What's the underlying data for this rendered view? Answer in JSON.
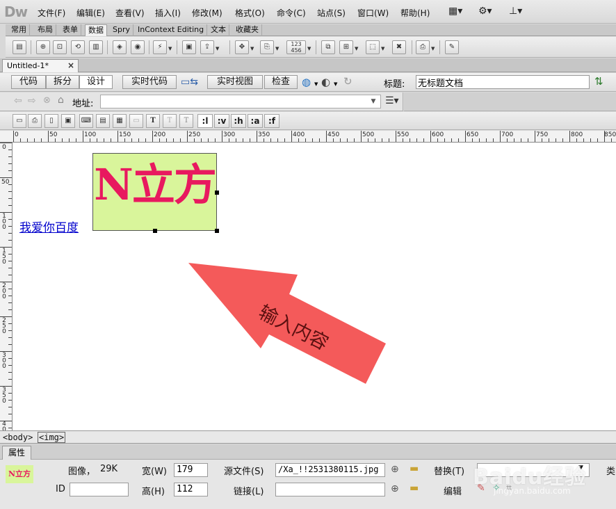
{
  "app": {
    "logo": "Dw"
  },
  "menu": {
    "items": [
      "文件(F)",
      "编辑(E)",
      "查看(V)",
      "插入(I)",
      "修改(M)",
      "格式(O)",
      "命令(C)",
      "站点(S)",
      "窗口(W)",
      "帮助(H)"
    ]
  },
  "insert_tabs": [
    "常用",
    "布局",
    "表单",
    "数据",
    "Spry",
    "InContext Editing",
    "文本",
    "收藏夹"
  ],
  "insert_tabs_active": "数据",
  "document": {
    "tab_title": "Untitled-1*",
    "close_glyph": "×"
  },
  "doc_toolbar": {
    "code": "代码",
    "split": "拆分",
    "design": "设计",
    "live_code": "实时代码",
    "live_view": "实时视图",
    "inspect": "检查",
    "title_label": "标题:",
    "title_value": "无标题文档"
  },
  "address": {
    "label": "地址:",
    "value": ""
  },
  "style_bar": {
    "buttons": [
      ":l",
      ":v",
      ":h",
      ":a",
      ":f"
    ]
  },
  "ruler": {
    "top": [
      "0",
      "50",
      "100",
      "150",
      "200",
      "250",
      "300",
      "350",
      "400",
      "450",
      "500",
      "550",
      "600",
      "650",
      "700",
      "750",
      "800",
      "850"
    ],
    "left": [
      "0",
      "50",
      "100",
      "150",
      "200",
      "250",
      "300",
      "350",
      "400"
    ]
  },
  "canvas": {
    "link_text": "我爱你百度",
    "image_text": "N立方",
    "image_bg": "#d9f59b",
    "image_fg": "#e8195f",
    "annotation_text": "输入内容",
    "arrow_color": "#f45a5a"
  },
  "tag_selector": [
    "<body>",
    "<img>"
  ],
  "properties": {
    "tab": "属性",
    "thumb_text": "N立方",
    "type_label": "图像，",
    "size": "29K",
    "width_label": "宽(W)",
    "width_value": "179",
    "height_label": "高(H)",
    "height_value": "112",
    "src_label": "源文件(S)",
    "src_value": "/Xa_!!2531380115.jpg",
    "alt_label": "替换(T)",
    "id_label": "ID",
    "id_value": "",
    "link_label": "链接(L)",
    "link_value": "",
    "edit_label": "编辑",
    "class_label": "类"
  },
  "watermark": {
    "main": "Baidu经验",
    "sub": "jingyan.baidu.com"
  }
}
